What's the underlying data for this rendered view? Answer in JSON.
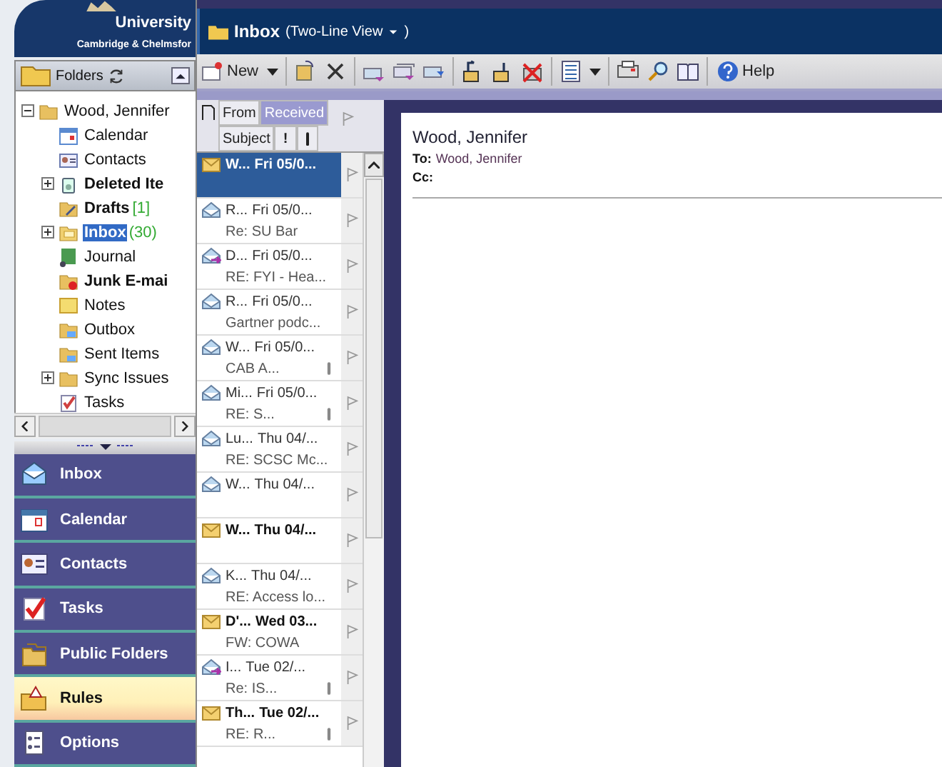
{
  "logo": {
    "name": "University",
    "campus": "Cambridge & Chelmsfor"
  },
  "folders_panel": {
    "title": "Folders"
  },
  "folder_tree": [
    {
      "label": "Wood, Jennifer",
      "kind": "mailbox",
      "bold": false,
      "selected": false,
      "expanded": true,
      "children": [
        {
          "label": "Calendar",
          "kind": "calendar",
          "bold": false,
          "selected": false
        },
        {
          "label": "Contacts",
          "kind": "contacts",
          "bold": false,
          "selected": false
        },
        {
          "label": "Deleted Ite",
          "kind": "trash",
          "bold": true,
          "selected": false,
          "expanded": false
        },
        {
          "label": "Drafts",
          "count": "[1]",
          "kind": "drafts",
          "bold": true,
          "selected": false
        },
        {
          "label": "Inbox",
          "count": "(30)",
          "kind": "inbox",
          "bold": true,
          "selected": true,
          "expanded": false
        },
        {
          "label": "Journal",
          "kind": "journal",
          "bold": false,
          "selected": false
        },
        {
          "label": "Junk E-mai",
          "kind": "junk",
          "bold": true,
          "selected": false
        },
        {
          "label": "Notes",
          "kind": "notes",
          "bold": false,
          "selected": false
        },
        {
          "label": "Outbox",
          "kind": "outbox",
          "bold": false,
          "selected": false
        },
        {
          "label": "Sent Items",
          "kind": "sent",
          "bold": false,
          "selected": false
        },
        {
          "label": "Sync Issues",
          "kind": "folder",
          "bold": false,
          "selected": false,
          "expanded": false
        },
        {
          "label": "Tasks",
          "kind": "tasks",
          "bold": false,
          "selected": false
        }
      ]
    }
  ],
  "nav": [
    {
      "label": "Inbox",
      "kind": "inbox",
      "selected": false
    },
    {
      "label": "Calendar",
      "kind": "calendar",
      "selected": false
    },
    {
      "label": "Contacts",
      "kind": "contacts",
      "selected": false
    },
    {
      "label": "Tasks",
      "kind": "tasks",
      "selected": false
    },
    {
      "label": "Public Folders",
      "kind": "public",
      "selected": false
    },
    {
      "label": "Rules",
      "kind": "rules",
      "selected": true
    },
    {
      "label": "Options",
      "kind": "options",
      "selected": false
    }
  ],
  "header": {
    "title": "Inbox",
    "view_open": "(Two-Line View",
    "view_close": ")"
  },
  "toolbar": {
    "new_label": "New",
    "help_label": "Help"
  },
  "list_header": {
    "from": "From",
    "received": "Received",
    "received_selected": true,
    "subject": "Subject",
    "importance": "!"
  },
  "messages": [
    {
      "sender": "W...",
      "date": "Fri 05/0...",
      "unread": true,
      "replied": false,
      "attachment": false,
      "selected": true
    },
    {
      "sender": "R...",
      "date": "Fri 05/0...",
      "subject": "Re: SU Bar",
      "unread": false,
      "replied": false,
      "attachment": false,
      "selected": false
    },
    {
      "sender": "D...",
      "date": "Fri 05/0...",
      "subject": "RE: FYI - Hea...",
      "unread": false,
      "replied": true,
      "attachment": false,
      "selected": false
    },
    {
      "sender": "R...",
      "date": "Fri 05/0...",
      "subject": "Gartner podc...",
      "unread": false,
      "replied": false,
      "attachment": false,
      "selected": false
    },
    {
      "sender": "W...",
      "date": "Fri 05/0...",
      "subject": "CAB A...",
      "unread": false,
      "replied": false,
      "attachment": true,
      "selected": false
    },
    {
      "sender": "Mi...",
      "date": "Fri 05/0...",
      "subject": "RE: S...",
      "unread": false,
      "replied": false,
      "attachment": true,
      "selected": false
    },
    {
      "sender": "Lu...",
      "date": "Thu 04/...",
      "subject": "RE: SCSC Mc...",
      "unread": false,
      "replied": false,
      "attachment": false,
      "selected": false
    },
    {
      "sender": "W...",
      "date": "Thu 04/...",
      "unread": false,
      "replied": false,
      "attachment": false,
      "selected": false
    },
    {
      "sender": "W...",
      "date": "Thu 04/...",
      "unread": true,
      "replied": false,
      "attachment": false,
      "selected": false
    },
    {
      "sender": "K...",
      "date": "Thu 04/...",
      "subject": "RE: Access lo...",
      "unread": false,
      "replied": false,
      "attachment": false,
      "selected": false
    },
    {
      "sender": "D'...",
      "date": "Wed 03...",
      "subject": "FW: COWA",
      "unread": true,
      "replied": false,
      "attachment": false,
      "selected": false
    },
    {
      "sender": "I...",
      "date": "Tue 02/...",
      "subject": "Re: IS...",
      "unread": false,
      "replied": true,
      "attachment": true,
      "selected": false
    },
    {
      "sender": "Th...",
      "date": "Tue 02/...",
      "subject": "RE: R...",
      "unread": true,
      "replied": false,
      "attachment": true,
      "selected": false
    }
  ],
  "reading_pane": {
    "from": "Wood, Jennifer",
    "to_label": "To:",
    "to": "Wood, Jennifer",
    "cc_label": "Cc:"
  }
}
